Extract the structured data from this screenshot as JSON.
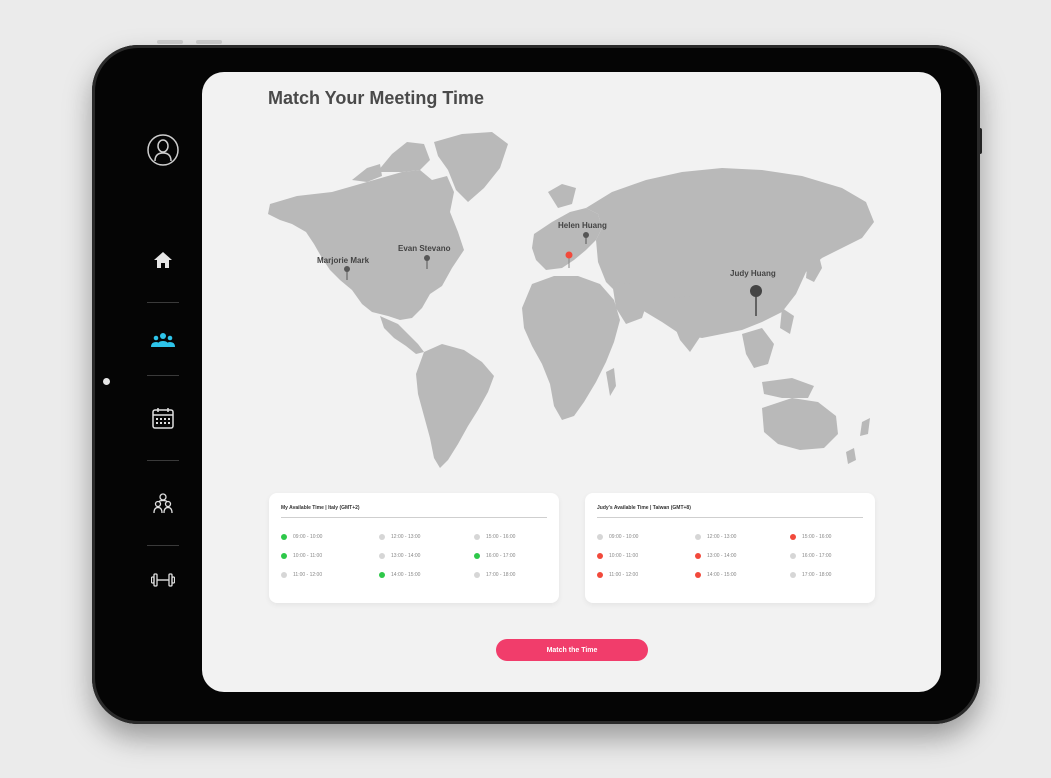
{
  "page": {
    "title": "Match Your Meeting Time"
  },
  "sidebar": {
    "items": [
      {
        "name": "profile-icon"
      },
      {
        "name": "home-icon"
      },
      {
        "name": "team-icon",
        "active": true
      },
      {
        "name": "calendar-icon"
      },
      {
        "name": "people-icon"
      },
      {
        "name": "dumbbell-icon"
      }
    ]
  },
  "map": {
    "pins": [
      {
        "label": "Marjorie Mark",
        "color": "#555555"
      },
      {
        "label": "Evan Stevano",
        "color": "#555555"
      },
      {
        "label": "Helen Huang",
        "color": "#555555"
      },
      {
        "label": "Judy Huang",
        "color": "#444444"
      }
    ],
    "selected_pin_color": "#f2493b"
  },
  "cards": [
    {
      "title": "My Available Time | Italy (GMT+2)",
      "slots": [
        {
          "time": "09:00 - 10:00",
          "status": "available"
        },
        {
          "time": "12:00 - 13:00",
          "status": "none"
        },
        {
          "time": "15:00 - 16:00",
          "status": "none"
        },
        {
          "time": "10:00 - 11:00",
          "status": "available"
        },
        {
          "time": "13:00 - 14:00",
          "status": "none"
        },
        {
          "time": "16:00 - 17:00",
          "status": "available"
        },
        {
          "time": "11:00 - 12:00",
          "status": "none"
        },
        {
          "time": "14:00 - 15:00",
          "status": "available"
        },
        {
          "time": "17:00 - 18:00",
          "status": "none"
        }
      ]
    },
    {
      "title": "Judy's Available Time | Taiwan (GMT+8)",
      "slots": [
        {
          "time": "09:00 - 10:00",
          "status": "none"
        },
        {
          "time": "12:00 - 13:00",
          "status": "none"
        },
        {
          "time": "15:00 - 16:00",
          "status": "busy"
        },
        {
          "time": "10:00 - 11:00",
          "status": "busy"
        },
        {
          "time": "13:00 - 14:00",
          "status": "busy"
        },
        {
          "time": "16:00 - 17:00",
          "status": "none"
        },
        {
          "time": "11:00 - 12:00",
          "status": "busy"
        },
        {
          "time": "14:00 - 15:00",
          "status": "busy"
        },
        {
          "time": "17:00 - 18:00",
          "status": "none"
        }
      ]
    }
  ],
  "actions": {
    "match_label": "Match the Time"
  },
  "colors": {
    "accent": "#f13d6b",
    "active_nav": "#2ec4ea",
    "available": "#2ec84a",
    "busy": "#f2493b",
    "neutral": "#d6d6d6",
    "land": "#b9b9b9"
  }
}
